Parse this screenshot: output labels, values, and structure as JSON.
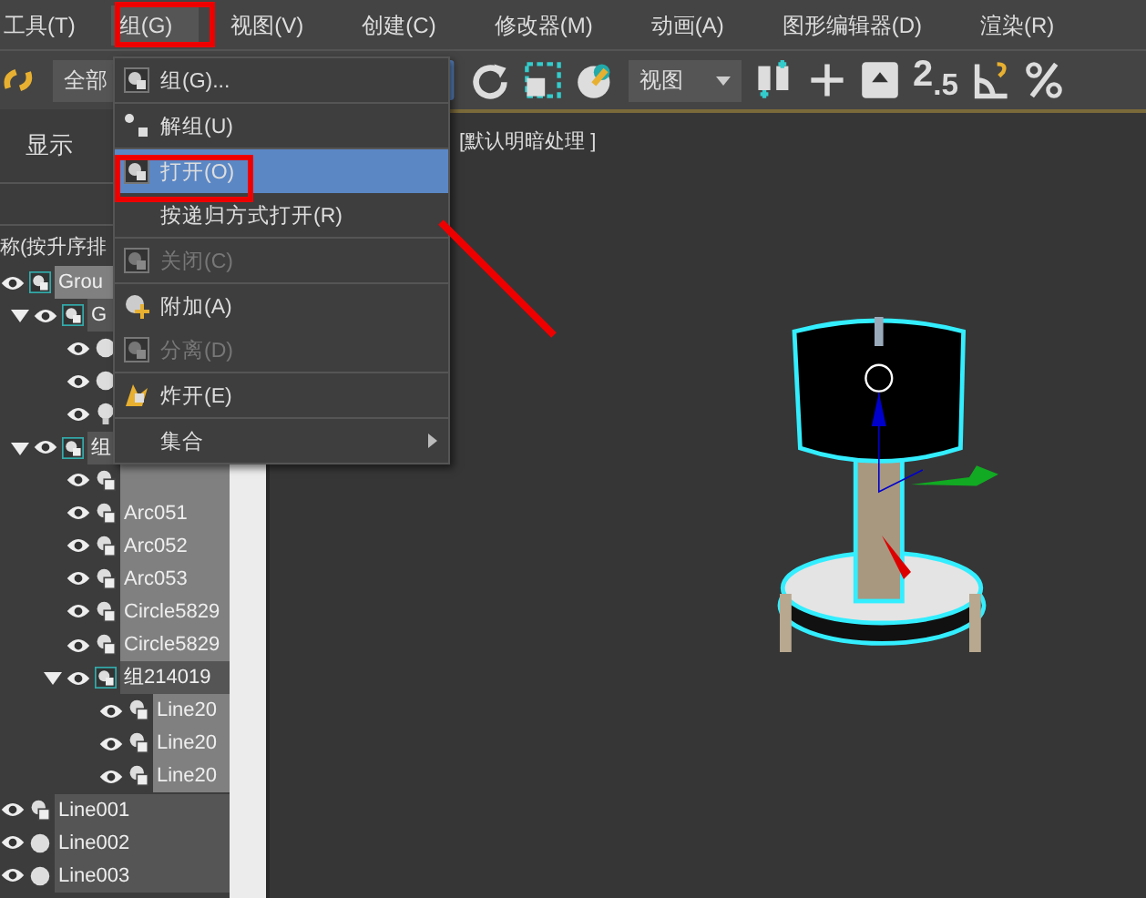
{
  "menubar": [
    {
      "label": "工具(T)",
      "selected": false
    },
    {
      "label": "组(G)",
      "selected": true
    },
    {
      "label": "视图(V)",
      "selected": false
    },
    {
      "label": "创建(C)",
      "selected": false
    },
    {
      "label": "修改器(M)",
      "selected": false
    },
    {
      "label": "动画(A)",
      "selected": false
    },
    {
      "label": "图形编辑器(D)",
      "selected": false
    },
    {
      "label": "渲染(R)",
      "selected": false
    }
  ],
  "toolbar": {
    "selection_filter": "全部",
    "coordinate_dropdown": "视图",
    "snap_icon": "2$_{.5}$"
  },
  "group_menu": [
    [
      {
        "label": "组(G)...",
        "kind": "group",
        "selected": false,
        "disabled": false
      }
    ],
    [
      {
        "label": "解组(U)",
        "kind": "ungroup",
        "selected": false,
        "disabled": false
      }
    ],
    [
      {
        "label": "打开(O)",
        "kind": "group",
        "selected": true,
        "disabled": false
      },
      {
        "label": "按递归方式打开(R)",
        "kind": "none",
        "selected": false,
        "disabled": false
      }
    ],
    [
      {
        "label": "关闭(C)",
        "kind": "group",
        "selected": false,
        "disabled": true
      }
    ],
    [
      {
        "label": "附加(A)",
        "kind": "attach",
        "selected": false,
        "disabled": false
      },
      {
        "label": "分离(D)",
        "kind": "group",
        "selected": false,
        "disabled": true
      }
    ],
    [
      {
        "label": "炸开(E)",
        "kind": "explode",
        "selected": false,
        "disabled": false
      }
    ],
    [
      {
        "label": "集合",
        "kind": "submenu",
        "selected": false,
        "disabled": false
      }
    ]
  ],
  "scene_panel": {
    "tab": "显示",
    "column_header": "称(按升序排"
  },
  "tree": [
    {
      "name": "Grou",
      "kind": "group",
      "selected": true,
      "children": [
        {
          "name": "G",
          "kind": "group",
          "selected": false,
          "expanded": true,
          "children": [
            {
              "kind": "sphere"
            },
            {
              "kind": "sphere"
            },
            {
              "kind": "light"
            }
          ]
        },
        {
          "name": "组",
          "kind": "group",
          "selected": false,
          "expanded": true,
          "children": [
            {
              "kind": "shape",
              "selected": true
            },
            {
              "name": "Arc051",
              "kind": "shape",
              "selected": true
            },
            {
              "name": "Arc052",
              "kind": "shape",
              "selected": true
            },
            {
              "name": "Arc053",
              "kind": "shape",
              "selected": true
            },
            {
              "name": "Circle5829",
              "kind": "shape",
              "selected": true
            },
            {
              "name": "Circle5829",
              "kind": "shape",
              "selected": true
            },
            {
              "name": "组214019",
              "kind": "group",
              "selected": false,
              "expanded": true,
              "children": [
                {
                  "name": "Line20",
                  "kind": "shape",
                  "selected": true
                },
                {
                  "name": "Line20",
                  "kind": "shape",
                  "selected": true
                },
                {
                  "name": "Line20",
                  "kind": "shape",
                  "selected": true
                }
              ]
            }
          ]
        }
      ]
    },
    {
      "name": "Line001",
      "kind": "shape",
      "selected": false
    },
    {
      "name": "Line002",
      "kind": "sphere",
      "selected": false
    },
    {
      "name": "Line003",
      "kind": "sphere",
      "selected": false
    }
  ],
  "viewport": {
    "label": "[默认明暗处理 ]"
  }
}
